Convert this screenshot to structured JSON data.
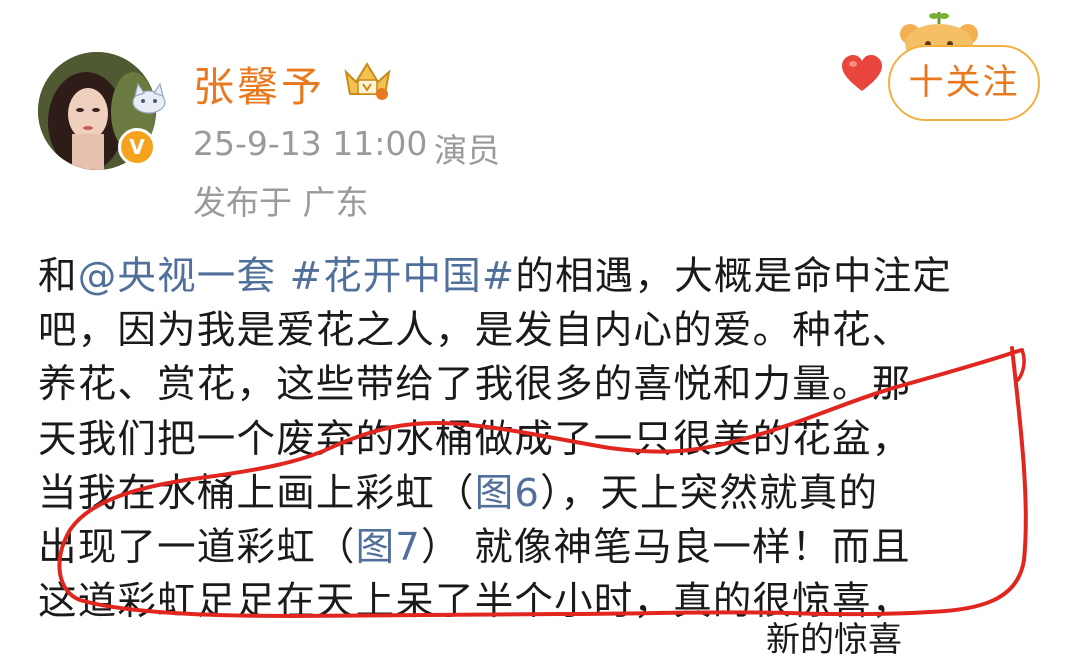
{
  "author": {
    "name": "张馨予",
    "time": "25-9-13 11:00",
    "role": "演员",
    "location": "发布于 广东",
    "badge": "V",
    "icons": [
      "avatar-photo",
      "cat-decoration",
      "crown-icon",
      "verified-badge-icon"
    ]
  },
  "header_right": {
    "follow_label": "十关注",
    "icons": [
      "heart-icon",
      "bear-decoration"
    ]
  },
  "post": {
    "lines": [
      [
        {
          "t": "和",
          "link": false
        },
        {
          "t": "@央视一套",
          "link": true
        },
        {
          "t": " ",
          "link": false
        },
        {
          "t": "#花开中国#",
          "link": true
        },
        {
          "t": "的相遇，大概是命中注定",
          "link": false
        }
      ],
      [
        {
          "t": "吧，因为我是爱花之人，是发自内心的爱。种花、",
          "link": false
        }
      ],
      [
        {
          "t": "养花、赏花，这些带给了我很多的喜悦和力量。那",
          "link": false
        }
      ],
      [
        {
          "t": "天我们把一个废弃的水桶做成了一只很美的花盆，",
          "link": false
        }
      ],
      [
        {
          "t": "当我在水桶上画上彩虹（",
          "link": false
        },
        {
          "t": "图6",
          "link": true
        },
        {
          "t": "），天上突然就真的",
          "link": false
        }
      ],
      [
        {
          "t": "出现了一道彩虹（",
          "link": false
        },
        {
          "t": "图7",
          "link": true
        },
        {
          "t": "） 就像神笔马良一样！而且",
          "link": false
        }
      ],
      [
        {
          "t": "这道彩虹足足在天上呆了半个小时，真的很惊喜，",
          "link": false
        }
      ]
    ],
    "watermark": "新的惊喜",
    "colors": {
      "text": "#1a1a1a",
      "link": "#50709b",
      "meta": "#9a9a9a",
      "brand": "#e8791f",
      "annotation": "#e0261f"
    }
  }
}
